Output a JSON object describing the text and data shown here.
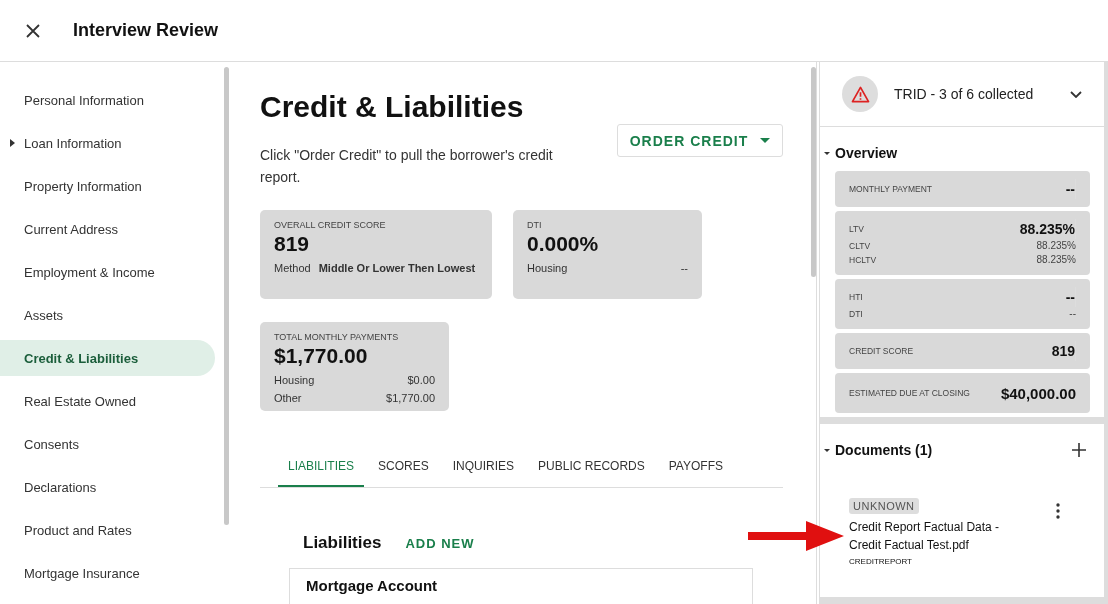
{
  "header": {
    "title": "Interview Review"
  },
  "sidebar": {
    "items": [
      {
        "label": "Personal Information",
        "kind": "item",
        "selected": false
      },
      {
        "label": "Loan Information",
        "kind": "group",
        "selected": false
      },
      {
        "label": "Property Information",
        "kind": "item",
        "selected": false
      },
      {
        "label": "Current Address",
        "kind": "item",
        "selected": false
      },
      {
        "label": "Employment & Income",
        "kind": "item",
        "selected": false
      },
      {
        "label": "Assets",
        "kind": "item",
        "selected": false
      },
      {
        "label": "Credit & Liabilities",
        "kind": "item",
        "selected": true
      },
      {
        "label": "Real Estate Owned",
        "kind": "item",
        "selected": false
      },
      {
        "label": "Consents",
        "kind": "item",
        "selected": false
      },
      {
        "label": "Declarations",
        "kind": "item",
        "selected": false
      },
      {
        "label": "Product and Rates",
        "kind": "item",
        "selected": false
      },
      {
        "label": "Mortgage Insurance",
        "kind": "item",
        "selected": false
      }
    ]
  },
  "main": {
    "title": "Credit & Liabilities",
    "order_button": "ORDER CREDIT",
    "hint": "Click \"Order Credit\" to pull the borrower's credit report.",
    "cards": [
      {
        "label": "OVERALL CREDIT SCORE",
        "value": "819",
        "rows": [
          {
            "kind": "inline",
            "label": "Method",
            "value": "Middle Or Lower Then Lowest"
          }
        ]
      },
      {
        "label": "DTI",
        "value": "0.000%",
        "rows": [
          {
            "kind": "spread",
            "label": "Housing",
            "value": "--"
          }
        ]
      },
      {
        "label": "TOTAL MONTHLY PAYMENTS",
        "value": "$1,770.00",
        "rows": [
          {
            "kind": "spread",
            "label": "Housing",
            "value": "$0.00"
          },
          {
            "kind": "spread",
            "label": "Other",
            "value": "$1,770.00"
          }
        ]
      }
    ],
    "tabs": [
      {
        "label": "LIABILITIES",
        "selected": true
      },
      {
        "label": "SCORES",
        "selected": false
      },
      {
        "label": "INQUIRIES",
        "selected": false
      },
      {
        "label": "PUBLIC RECORDS",
        "selected": false
      },
      {
        "label": "PAYOFFS",
        "selected": false
      }
    ],
    "liabilities": {
      "title": "Liabilities",
      "add_button": "ADD NEW",
      "card_title": "Mortgage Account"
    }
  },
  "right_panel": {
    "status": {
      "label": "TRID - 3 of 6 collected"
    },
    "overview": {
      "title": "Overview",
      "cards": [
        {
          "rows": [
            {
              "kind": "main",
              "label": "MONTHLY PAYMENT",
              "value": "--"
            }
          ]
        },
        {
          "rows": [
            {
              "kind": "main",
              "label": "LTV",
              "value": "88.235%"
            },
            {
              "kind": "sub",
              "label": "CLTV",
              "value": "88.235%"
            },
            {
              "kind": "sub",
              "label": "HCLTV",
              "value": "88.235%"
            }
          ]
        },
        {
          "rows": [
            {
              "kind": "main",
              "label": "HTI",
              "value": "--"
            },
            {
              "kind": "sub",
              "label": "DTI",
              "value": "--"
            }
          ]
        },
        {
          "rows": [
            {
              "kind": "main",
              "label": "CREDIT SCORE",
              "value": "819"
            }
          ]
        },
        {
          "rows": [
            {
              "kind": "big",
              "label": "ESTIMATED DUE AT CLOSING",
              "value": "$40,000.00"
            }
          ]
        }
      ]
    },
    "documents": {
      "title": "Documents (1)",
      "items": [
        {
          "badge": "UNKNOWN",
          "name": "Credit Report Factual Data - Credit Factual Test.pdf",
          "type": "CREDITREPORT"
        }
      ]
    }
  }
}
